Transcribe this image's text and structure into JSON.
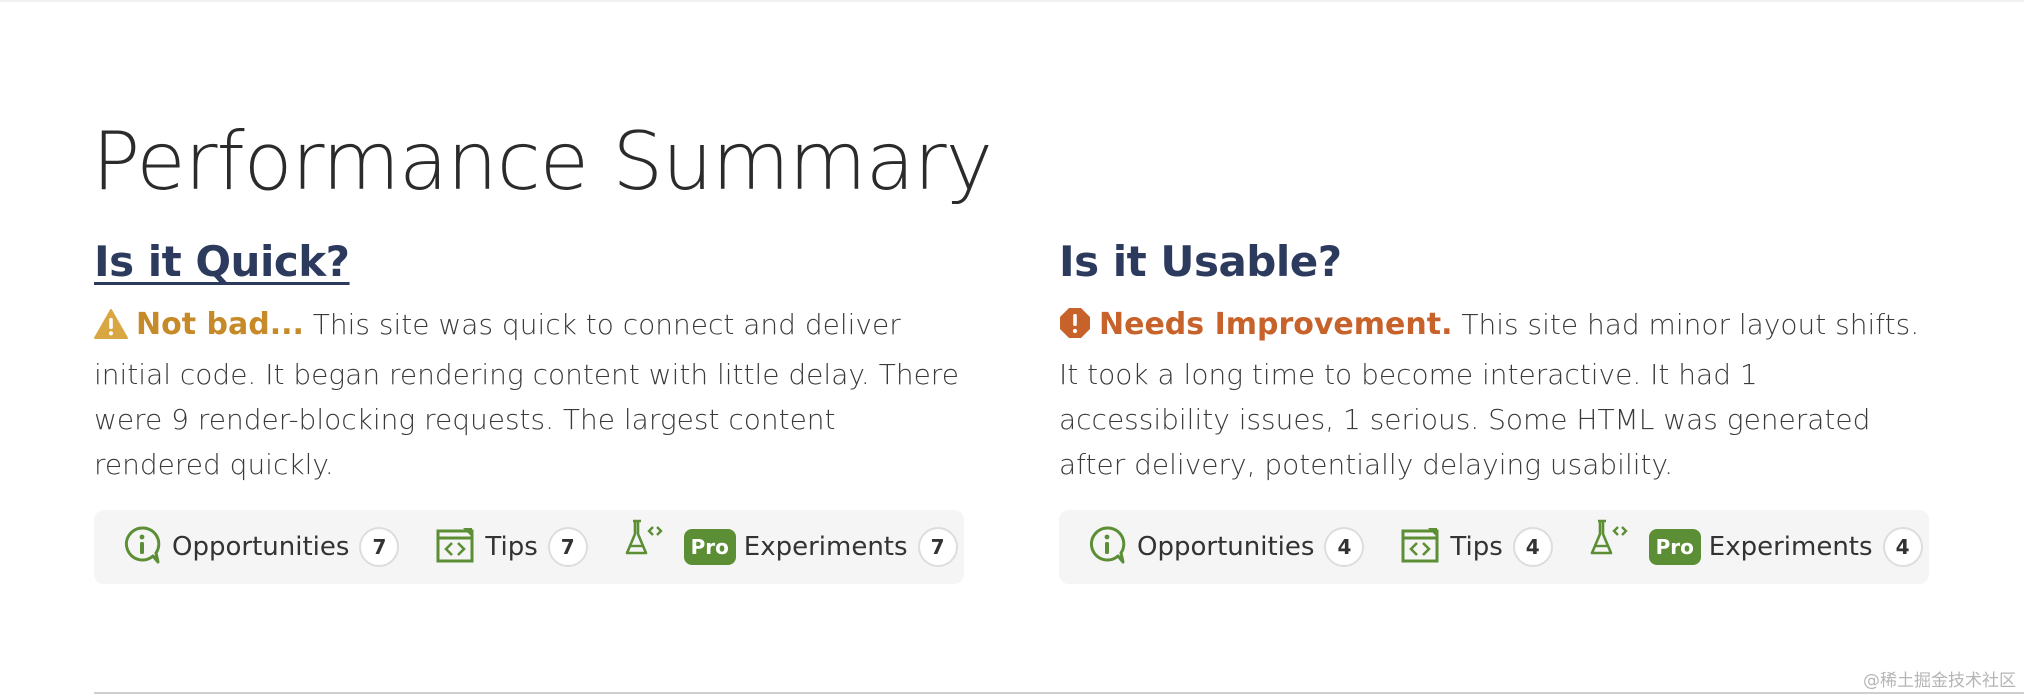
{
  "page": {
    "title": "Performance Summary",
    "watermark": "@稀土掘金技术社区"
  },
  "colors": {
    "heading": "#2c3a5e",
    "warn": "#c68a28",
    "bad": "#c8622b",
    "icon_green": "#5c8f35",
    "toolbar_bg": "#f5f5f5"
  },
  "quick": {
    "heading": "Is it Quick?",
    "status_icon": "warning-triangle-icon",
    "verdict": "Not bad...",
    "text": " This site was quick to connect and deliver initial code. It began rendering content with little delay. There were 9 render-blocking requests. The largest content rendered quickly.",
    "toolbar": {
      "opportunities_label": "Opportunities",
      "opportunities_count": "7",
      "tips_label": "Tips",
      "tips_count": "7",
      "pro_label": "Pro",
      "experiments_label": "Experiments",
      "experiments_count": "7"
    }
  },
  "usable": {
    "heading": "Is it Usable?",
    "status_icon": "error-octagon-icon",
    "verdict": "Needs Improvement.",
    "text": " This site had minor layout shifts. It took a long time to become interactive. It had 1 accessibility issues, 1 serious. Some HTML was generated after delivery, potentially delaying usability.",
    "toolbar": {
      "opportunities_label": "Opportunities",
      "opportunities_count": "4",
      "tips_label": "Tips",
      "tips_count": "4",
      "pro_label": "Pro",
      "experiments_label": "Experiments",
      "experiments_count": "4"
    }
  }
}
